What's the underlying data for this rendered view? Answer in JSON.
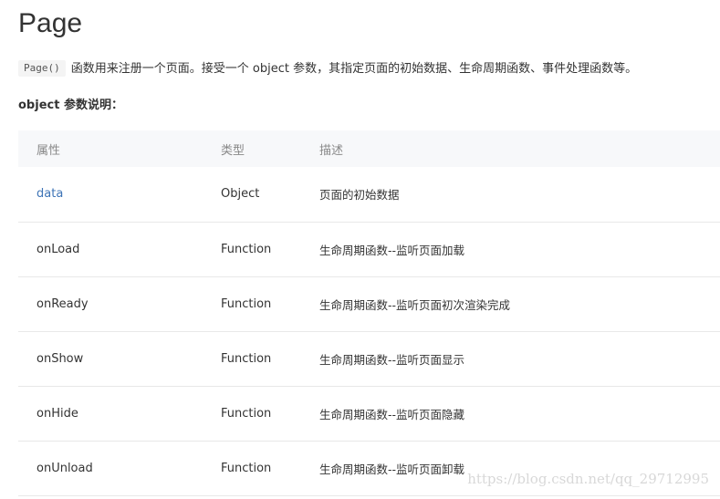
{
  "title": "Page",
  "intro": {
    "code": "Page()",
    "text": "函数用来注册一个页面。接受一个 object 参数，其指定页面的初始数据、生命周期函数、事件处理函数等。"
  },
  "section_heading": "object 参数说明：",
  "table": {
    "headers": [
      "属性",
      "类型",
      "描述"
    ],
    "rows": [
      {
        "name": "data",
        "type": "Object",
        "desc": "页面的初始数据"
      },
      {
        "name": "onLoad",
        "type": "Function",
        "desc": "生命周期函数--监听页面加载"
      },
      {
        "name": "onReady",
        "type": "Function",
        "desc": "生命周期函数--监听页面初次渲染完成"
      },
      {
        "name": "onShow",
        "type": "Function",
        "desc": "生命周期函数--监听页面显示"
      },
      {
        "name": "onHide",
        "type": "Function",
        "desc": "生命周期函数--监听页面隐藏"
      },
      {
        "name": "onUnload",
        "type": "Function",
        "desc": "生命周期函数--监听页面卸载"
      }
    ]
  },
  "watermark": "https://blog.csdn.net/qq_29712995",
  "colors": {
    "link": "#3e74b6",
    "header_bg": "#f7f8fa",
    "text": "#333333"
  }
}
